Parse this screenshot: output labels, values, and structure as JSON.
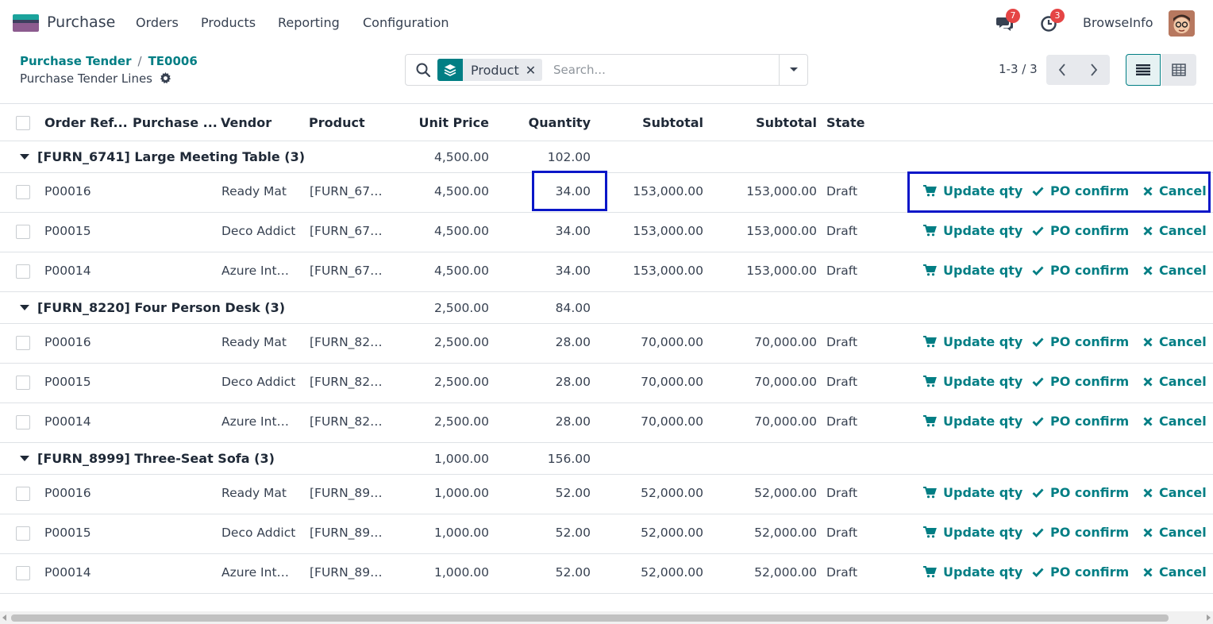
{
  "navbar": {
    "app_title": "Purchase",
    "menu": [
      "Orders",
      "Products",
      "Reporting",
      "Configuration"
    ],
    "messages_count": "7",
    "activities_count": "3",
    "company": "BrowseInfo",
    "icons": [
      "chat-icon",
      "clock-icon"
    ]
  },
  "breadcrumb": {
    "parent": "Purchase Tender",
    "current": "TE0006",
    "separator": "/",
    "subtitle": "Purchase Tender Lines"
  },
  "search": {
    "facet_label": "Product",
    "placeholder": "Search..."
  },
  "pager": {
    "value": "1-3 / 3"
  },
  "columns": [
    "Order Ref...",
    "Purchase ...",
    "Vendor",
    "Product",
    "Unit Price",
    "Quantity",
    "Subtotal",
    "Subtotal",
    "State"
  ],
  "actions": {
    "update": "Update qty",
    "confirm": "PO confirm",
    "cancel": "Cancel"
  },
  "groups": [
    {
      "label": "[FURN_6741] Large Meeting Table (3)",
      "unit_price": "4,500.00",
      "quantity": "102.00",
      "rows": [
        {
          "ref": "P00016",
          "vendor": "Ready Mat",
          "product": "[FURN_67…",
          "unit_price": "4,500.00",
          "quantity": "34.00",
          "subtotal": "153,000.00",
          "subtotal2": "153,000.00",
          "state": "Draft"
        },
        {
          "ref": "P00015",
          "vendor": "Deco Addict",
          "product": "[FURN_67…",
          "unit_price": "4,500.00",
          "quantity": "34.00",
          "subtotal": "153,000.00",
          "subtotal2": "153,000.00",
          "state": "Draft"
        },
        {
          "ref": "P00014",
          "vendor": "Azure Int…",
          "product": "[FURN_67…",
          "unit_price": "4,500.00",
          "quantity": "34.00",
          "subtotal": "153,000.00",
          "subtotal2": "153,000.00",
          "state": "Draft"
        }
      ]
    },
    {
      "label": "[FURN_8220] Four Person Desk (3)",
      "unit_price": "2,500.00",
      "quantity": "84.00",
      "rows": [
        {
          "ref": "P00016",
          "vendor": "Ready Mat",
          "product": "[FURN_82…",
          "unit_price": "2,500.00",
          "quantity": "28.00",
          "subtotal": "70,000.00",
          "subtotal2": "70,000.00",
          "state": "Draft"
        },
        {
          "ref": "P00015",
          "vendor": "Deco Addict",
          "product": "[FURN_82…",
          "unit_price": "2,500.00",
          "quantity": "28.00",
          "subtotal": "70,000.00",
          "subtotal2": "70,000.00",
          "state": "Draft"
        },
        {
          "ref": "P00014",
          "vendor": "Azure Int…",
          "product": "[FURN_82…",
          "unit_price": "2,500.00",
          "quantity": "28.00",
          "subtotal": "70,000.00",
          "subtotal2": "70,000.00",
          "state": "Draft"
        }
      ]
    },
    {
      "label": "[FURN_8999] Three-Seat Sofa (3)",
      "unit_price": "1,000.00",
      "quantity": "156.00",
      "rows": [
        {
          "ref": "P00016",
          "vendor": "Ready Mat",
          "product": "[FURN_89…",
          "unit_price": "1,000.00",
          "quantity": "52.00",
          "subtotal": "52,000.00",
          "subtotal2": "52,000.00",
          "state": "Draft"
        },
        {
          "ref": "P00015",
          "vendor": "Deco Addict",
          "product": "[FURN_89…",
          "unit_price": "1,000.00",
          "quantity": "52.00",
          "subtotal": "52,000.00",
          "subtotal2": "52,000.00",
          "state": "Draft"
        },
        {
          "ref": "P00014",
          "vendor": "Azure Int…",
          "product": "[FURN_89…",
          "unit_price": "1,000.00",
          "quantity": "52.00",
          "subtotal": "52,000.00",
          "subtotal2": "52,000.00",
          "state": "Draft"
        }
      ]
    }
  ],
  "colors": {
    "accent": "#017e84",
    "highlight": "#0a16c8",
    "badge": "#e54545"
  }
}
